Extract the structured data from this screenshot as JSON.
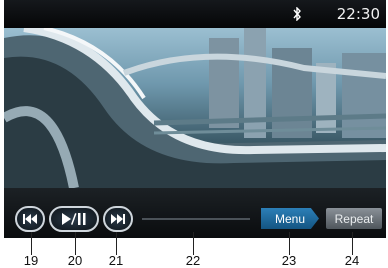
{
  "status_bar": {
    "icons": [
      "bluetooth-icon"
    ],
    "time": "22:30"
  },
  "controls": {
    "prev_icon": "skip-previous-icon",
    "play_pause_icon": "play-pause-icon",
    "next_icon": "skip-next-icon",
    "progress": 0,
    "menu_label": "Menu",
    "repeat_label": "Repeat"
  },
  "callouts": [
    "19",
    "20",
    "21",
    "22",
    "23",
    "24"
  ],
  "colors": {
    "menu_button": "#1f6ea3",
    "repeat_button": "#6c737a",
    "screen_bg": "#0b0d10"
  }
}
